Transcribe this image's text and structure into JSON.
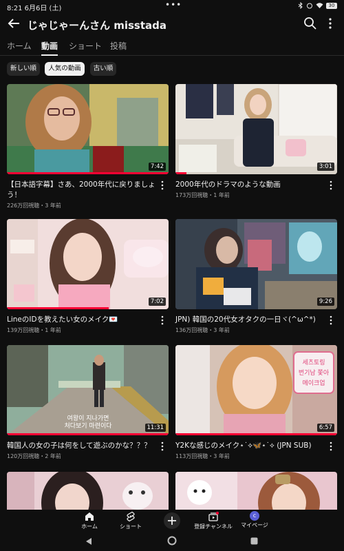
{
  "status_bar": {
    "time": "8:21",
    "date": "6月6日 (土)",
    "dots": "•••",
    "battery": "30"
  },
  "header": {
    "channel_title": "じゃじゃーんさん misstada"
  },
  "tabs": [
    {
      "label": "ホーム",
      "active": false
    },
    {
      "label": "動画",
      "active": true
    },
    {
      "label": "ショート",
      "active": false
    },
    {
      "label": "投稿",
      "active": false
    }
  ],
  "chips": [
    {
      "label": "新しい順",
      "selected": false
    },
    {
      "label": "人気の動画",
      "selected": true
    },
    {
      "label": "古い順",
      "selected": false
    }
  ],
  "videos": [
    {
      "title": "【日本語字幕】さあ、2000年代に戻りましょう！",
      "meta": "226万回視聴・3 年前",
      "duration": "7:42",
      "watched": 1.0
    },
    {
      "title": "2000年代のドラマのような動画",
      "meta": "173万回視聴・1 年前",
      "duration": "3:01",
      "watched": 0.07
    },
    {
      "title": "LineのIDを教えたい女のメイク💌",
      "meta": "139万回視聴・1 年前",
      "duration": "7:02",
      "watched": 0.63
    },
    {
      "title": "JPN) 韓国の20代女オタクの一日ヾ(^ω^*)",
      "meta": "136万回視聴・3 年前",
      "duration": "9:26",
      "watched": 0.0
    },
    {
      "title": "韓国人の女の子は何をして遊ぶのかな？？？",
      "meta": "120万回視聴・2 年前",
      "duration": "11:31",
      "watched": 1.0,
      "subtitle_line1": "여왕이 지나가면",
      "subtitle_line2": "처다보기 마련이다"
    },
    {
      "title": "Y2Kな感じのメイク⋆˙⟡🦋⋆˙⟡ (JPN SUB)",
      "meta": "113万回視聴・3 年前",
      "duration": "6:57",
      "watched": 1.0,
      "sign_line1": "세츠토링",
      "sign_line2": "번기남 쫓아",
      "sign_line3": "메이크업"
    },
    {
      "title": "",
      "meta": "",
      "duration": "",
      "watched": 0.0
    },
    {
      "title": "",
      "meta": "",
      "duration": "",
      "watched": 0.0
    }
  ],
  "bottom_nav": {
    "home": "ホーム",
    "shorts": "ショート",
    "subscriptions": "登録チャンネル",
    "you": "マイページ",
    "avatar_letter": "c"
  },
  "colors": {
    "accent": "#ff0033",
    "background": "#0f0f0f",
    "chip_bg": "#272727"
  }
}
